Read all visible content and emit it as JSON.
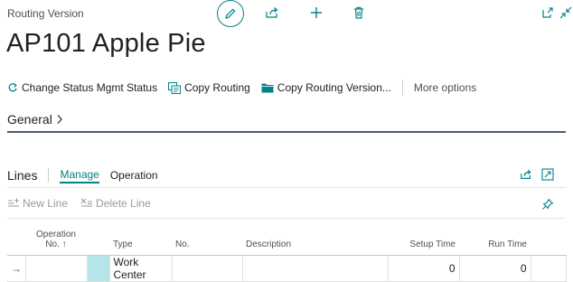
{
  "header": {
    "caption": "Routing Version",
    "title": "AP101 Apple Pie"
  },
  "actions": [
    {
      "label": "Change Status Mgmt Status",
      "icon": "status-icon"
    },
    {
      "label": "Copy Routing",
      "icon": "copy-routing-icon"
    },
    {
      "label": "Copy Routing Version...",
      "icon": "folder-icon"
    }
  ],
  "more_options": "More options",
  "general": {
    "title": "General"
  },
  "lines": {
    "title": "Lines",
    "tabs": [
      "Manage",
      "Operation"
    ],
    "new_line": "New Line",
    "delete_line": "Delete Line"
  },
  "table": {
    "columns": {
      "operation_no_1": "Operation",
      "operation_no_2": "No. ↑",
      "type": "Type",
      "no": "No.",
      "description": "Description",
      "setup_time": "Setup Time",
      "run_time": "Run Time"
    },
    "rows": [
      {
        "arrow": "→",
        "operation_no": "",
        "type": "Work Center",
        "no": "",
        "description": "",
        "setup_time": "0",
        "run_time": "0"
      }
    ]
  },
  "colors": {
    "accent": "#00838a",
    "rule": "#4a5d73",
    "row_highlight": "#b5e5e8"
  }
}
